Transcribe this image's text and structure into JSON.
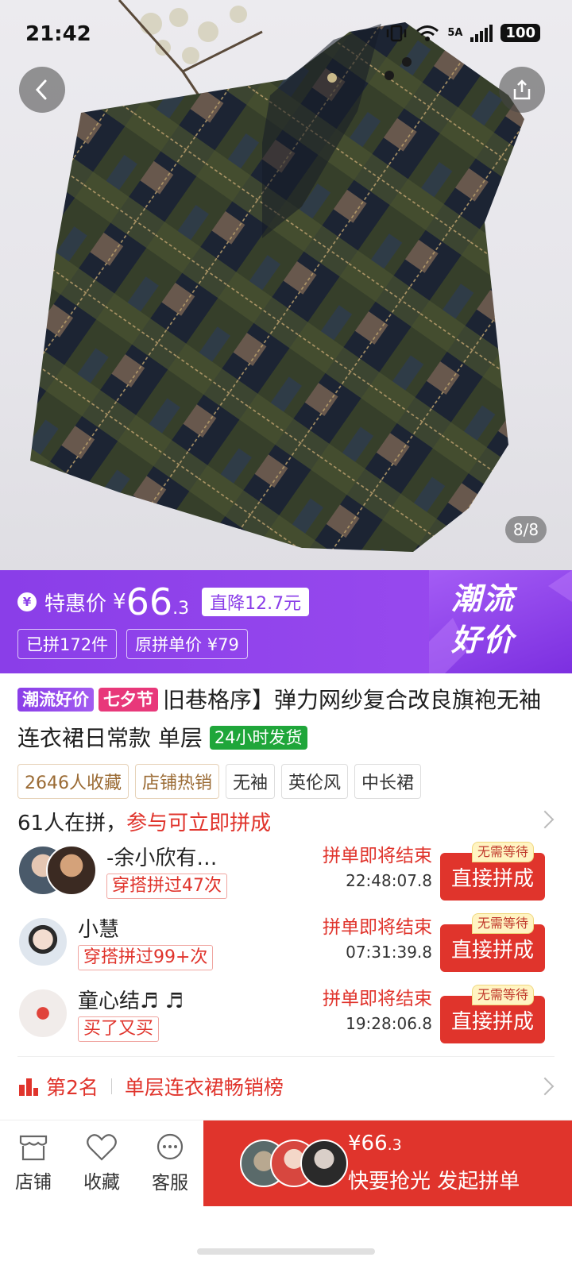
{
  "status_bar": {
    "time": "21:42",
    "network": "5A",
    "battery": "100"
  },
  "gallery": {
    "indicator": "8/8"
  },
  "promo": {
    "price_icon": "¥",
    "price_label": "特惠价",
    "currency": "¥",
    "price_int": "66",
    "price_dec": ".3",
    "drop_badge": "直降12.7元",
    "sold_chip": "已拼172件",
    "orig_chip": "原拼单价 ¥79",
    "slogan_line1": "潮流",
    "slogan_line2": "好价"
  },
  "product": {
    "tag1": "潮流好价",
    "tag2": "七夕节",
    "title_text": "旧巷格序】弹力网纱复合改良旗袍无袖连衣裙日常款 单层",
    "tag3": "24小时发货",
    "attributes": [
      "2646人收藏",
      "店铺热销",
      "无袖",
      "英伦风",
      "中长裙"
    ]
  },
  "group_section": {
    "count_text": "61人在拼，",
    "cta_text": "参与可立即拼成",
    "groups": [
      {
        "name": "-余小欣有…",
        "badge": "穿搭拼过47次",
        "end_label": "拼单即将结束",
        "timer": "22:48:07.8",
        "button": "直接拼成",
        "no_wait": "无需等待"
      },
      {
        "name": "小慧",
        "badge": "穿搭拼过99+次",
        "end_label": "拼单即将结束",
        "timer": "07:31:39.8",
        "button": "直接拼成",
        "no_wait": "无需等待"
      },
      {
        "name": "童心结♬ ♬",
        "badge": "买了又买",
        "end_label": "拼单即将结束",
        "timer": "19:28:06.8",
        "button": "直接拼成",
        "no_wait": "无需等待"
      }
    ]
  },
  "ranking": {
    "rank": "第2名",
    "list": "单层连衣裙畅销榜"
  },
  "bottom_bar": {
    "store": "店铺",
    "favorite": "收藏",
    "service": "客服",
    "buy_price_symbol": "¥",
    "buy_price_int": "66",
    "buy_price_dec": ".3",
    "buy_label": "快要抢光 发起拼单"
  },
  "colors": {
    "purple": "#8a3ee8",
    "red": "#e0342c",
    "green": "#1fa63a",
    "pink": "#e8387a"
  },
  "icons": [
    "back-arrow-icon",
    "share-icon",
    "store-icon",
    "heart-icon",
    "chat-icon",
    "ranking-bars-icon",
    "chevron-right-icon"
  ]
}
